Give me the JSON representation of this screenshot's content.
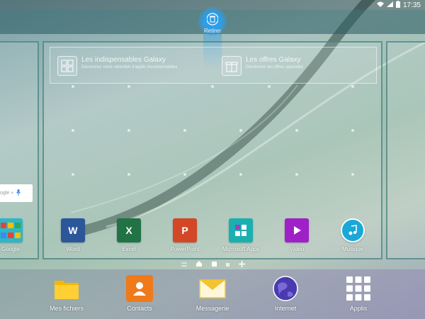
{
  "status_bar": {
    "time": "17:35",
    "wifi_icon": "wifi-icon",
    "signal_icon": "signal-icon",
    "battery_icon": "battery-icon"
  },
  "remove_zone": {
    "label": "Retirer",
    "icon": "trash-icon",
    "color": "#2e9ee8"
  },
  "widget": {
    "item1": {
      "title": "Les indispensables Galaxy",
      "subtitle": "Découvrez notre sélection d'applis incontournables"
    },
    "item2": {
      "title": "Les offres Galaxy",
      "subtitle": "Découvrez les offres spéciales"
    }
  },
  "search_widget": {
    "text": "ogle »",
    "mic_icon": "microphone-icon"
  },
  "apps": [
    {
      "label": "Google",
      "icon": "google-folder-icon"
    },
    {
      "label": "Word",
      "icon": "word-icon",
      "color": "#2b579a"
    },
    {
      "label": "Excel",
      "icon": "excel-icon",
      "color": "#217346"
    },
    {
      "label": "PowerPoint",
      "icon": "powerpoint-icon",
      "color": "#d24726"
    },
    {
      "label": "Microsoft Apps",
      "icon": "microsoft-apps-icon",
      "color": "#1ab0b0"
    },
    {
      "label": "Vidéo",
      "icon": "video-icon",
      "color": "#a020c8"
    },
    {
      "label": "Musique",
      "icon": "music-icon",
      "color": "#1aa8d8"
    }
  ],
  "dock": [
    {
      "label": "Mes fichiers",
      "icon": "folder-icon",
      "color": "#f5b800"
    },
    {
      "label": "Contacts",
      "icon": "contacts-icon",
      "color": "#f07a1a"
    },
    {
      "label": "Messagerie",
      "icon": "email-icon",
      "color": "#f3c430"
    },
    {
      "label": "Internet",
      "icon": "globe-icon",
      "color": "#4a3ab0"
    },
    {
      "label": "Applis",
      "icon": "apps-grid-icon",
      "color": "#ffffff"
    }
  ]
}
